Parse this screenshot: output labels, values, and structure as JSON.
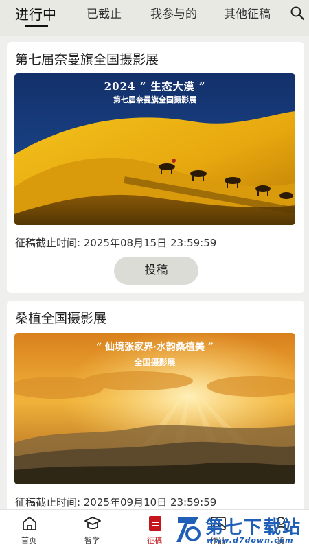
{
  "tabs": [
    {
      "label": "进行中",
      "active": true
    },
    {
      "label": "已截止",
      "active": false
    },
    {
      "label": "我参与的",
      "active": false
    },
    {
      "label": "其他征稿",
      "active": false
    }
  ],
  "search_icon": "search-icon",
  "contests": [
    {
      "title": "第七届奈曼旗全国摄影展",
      "banner_line1": "2024 “ 生态大漠 ”",
      "banner_line2": "第七届奈曼旗全国摄影展",
      "deadline": "征稿截止时间:  2025年08月15日 23:59:59",
      "button_label": "投稿"
    },
    {
      "title": "桑植全国摄影展",
      "banner_line1": "“ 仙境张家界·水韵桑植美 ”",
      "banner_line2": "全国摄影展",
      "deadline": "征稿截止时间:  2025年09月10日 23:59:59"
    }
  ],
  "bottom_nav": [
    {
      "label": "首页",
      "icon": "home-icon",
      "active": false
    },
    {
      "label": "智学",
      "icon": "graduation-cap-icon",
      "active": false
    },
    {
      "label": "征稿",
      "icon": "submission-icon",
      "active": true
    },
    {
      "label": "作品",
      "icon": "gallery-icon",
      "active": false
    },
    {
      "label": "我",
      "icon": "profile-icon",
      "active": false
    }
  ],
  "watermark": {
    "title": "第七下载站",
    "url": "www.d7down.com"
  },
  "colors": {
    "accent": "#c4161c",
    "tab_bg": "#e9e9e4",
    "page_bg": "#efefed",
    "button_bg": "#dcdcd6",
    "watermark": "#1f5fb8"
  }
}
